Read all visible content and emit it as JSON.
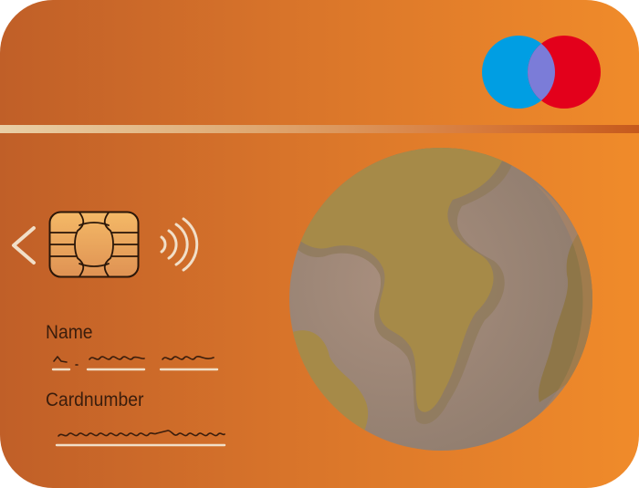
{
  "card": {
    "name_label": "Name",
    "cardnumber_label": "Cardnumber"
  },
  "icons": {
    "brand": "two-circle-card-brand-logo",
    "back": "chevron-left-icon",
    "chip": "chip-icon",
    "contactless": "contactless-icon",
    "globe": "globe-icon"
  },
  "colors": {
    "card_gradient_start": "#c05f28",
    "card_gradient_end": "#f08b2a",
    "logo_blue": "#009ee3",
    "logo_red": "#e3001b",
    "logo_overlap": "#7b7cd8",
    "text": "#3a1d0c"
  }
}
